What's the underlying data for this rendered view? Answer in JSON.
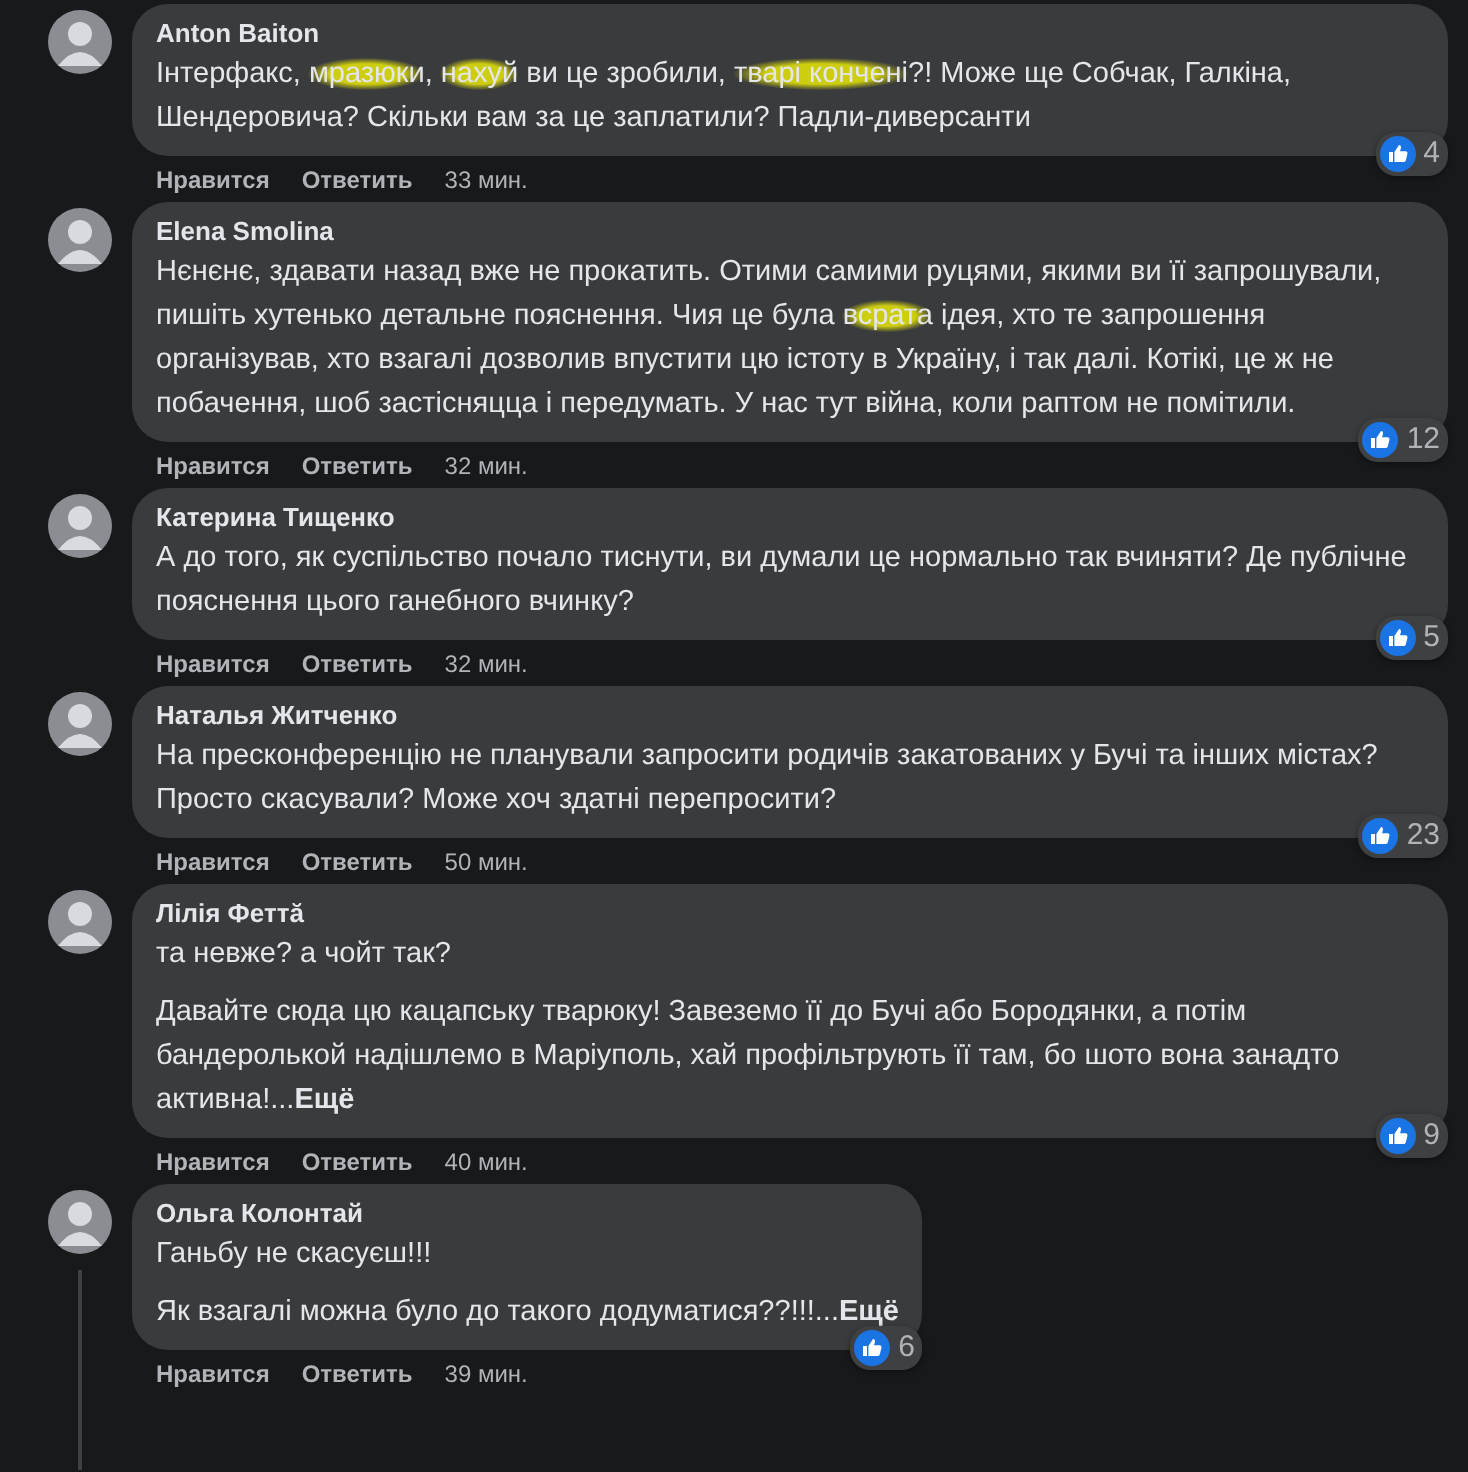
{
  "comments": [
    {
      "author": "Anton Baiton",
      "paragraphs": [
        [
          {
            "text": "Інтерфакс, "
          },
          {
            "text": "мразюки",
            "redacted": true
          },
          {
            "text": ", "
          },
          {
            "text": "нахуй",
            "redacted": true
          },
          {
            "text": " ви це зробили, "
          },
          {
            "text": "тварі кончені",
            "redacted": true
          },
          {
            "text": "?! Може ще Собчак, Галкіна, Шендеровича? Скільки вам за це заплатили? Падли-диверсанти"
          }
        ]
      ],
      "reactions": "4",
      "like": "Нравится",
      "reply": "Ответить",
      "time": "33 мин."
    },
    {
      "author": "Elena Smolina",
      "paragraphs": [
        [
          {
            "text": "Нєнєнє, здавати назад вже не прокатить. Отими самими руцями, якими ви її запрошували, пишіть хутенько детальне пояснення. Чия це була "
          },
          {
            "text": "всрата",
            "redacted": true
          },
          {
            "text": " ідея, хто те запрошення організував, хто взагалі дозволив впустити цю істоту в Україну, і так далі. Котікі, це ж не побачення, шоб застісняцца і передумать. У нас тут війна, коли раптом не помітили."
          }
        ]
      ],
      "reactions": "12",
      "like": "Нравится",
      "reply": "Ответить",
      "time": "32 мин."
    },
    {
      "author": "Катерина Тищенко",
      "paragraphs": [
        [
          {
            "text": "А до того, як суспільство почало тиснути, ви думали це нормально так вчиняти? Де публічне пояснення цього ганебного вчинку?"
          }
        ]
      ],
      "reactions": "5",
      "like": "Нравится",
      "reply": "Ответить",
      "time": "32 мин."
    },
    {
      "author": "Наталья Житченко",
      "paragraphs": [
        [
          {
            "text": "На пресконференцію не планували запросити родичів закатованих у Бучі та інших містах? Просто скасували? Може хоч здатні перепросити?"
          }
        ]
      ],
      "reactions": "23",
      "like": "Нравится",
      "reply": "Ответить",
      "time": "50 мин."
    },
    {
      "author": "Лілія Феттă",
      "paragraphs": [
        [
          {
            "text": "та невже? а чойт так?"
          }
        ],
        [
          {
            "text": "Давайте сюда цю кацапську тварюку! Завеземо її до Бучі або Бородянки, а потім бандеролькой надішлемо в Маріуполь, хай профільтрують її там, бо шото вона занадто активна!..."
          }
        ]
      ],
      "more": "Ещё",
      "reactions": "9",
      "like": "Нравится",
      "reply": "Ответить",
      "time": "40 мин."
    },
    {
      "author": "Ольга Колонтай",
      "paragraphs": [
        [
          {
            "text": "Ганьбу не скасуєш!!!"
          }
        ],
        [
          {
            "text": "Як взагалі можна було до такого додуматися??!!!..."
          }
        ]
      ],
      "more": "Ещё",
      "reactions": "6",
      "like": "Нравится",
      "reply": "Ответить",
      "time": "39 мин.",
      "thread_line": true
    }
  ]
}
